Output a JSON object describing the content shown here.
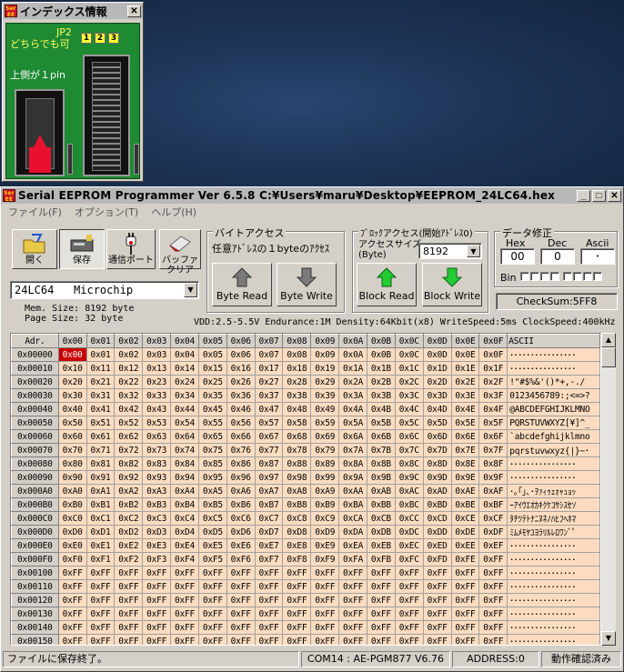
{
  "index_window": {
    "title": "インデックス情報",
    "close": "✕",
    "jp2": "JP2",
    "either_ok": "どちらでも可",
    "jumpers": [
      "1",
      "2",
      "3"
    ],
    "top_side": "上側が１pin",
    "icon_text": "Serial EE"
  },
  "main_window": {
    "title": "Serial EEPROM Programmer Ver 6.5.8  C:¥Users¥maru¥Desktop¥EEPROM_24LC64.hex",
    "icon_text": "Serial EE",
    "controls": {
      "minimize": "_",
      "maximize": "□",
      "close": "✕"
    },
    "menu": [
      "ファイル(F)",
      "オプション(T)",
      "ヘルプ(H)"
    ]
  },
  "toolbar": {
    "open": "開く",
    "save": "保存",
    "port": "通信ポート",
    "buffer_clear_1": "バッファ",
    "buffer_clear_2": "クリア"
  },
  "device": {
    "selected": "24LC64   Microchip",
    "mem_size": "Mem. Size: 8192 byte",
    "page_size": "Page Size: 32 byte",
    "spec": "VDD:2.5-5.5V Endurance:1M Density:64Kbit(x8) WriteSpeed:5ms ClockSpeed:400kHz"
  },
  "byte_access": {
    "group": "バイトアクセス",
    "hint": "任意ｱﾄﾞﾚｽの１byteのｱｸｾｽ",
    "read": "Byte Read",
    "write": "Byte Write"
  },
  "block_access": {
    "group": "ﾌﾞﾛｯｸアクセス(開始ｱﾄﾞﾚｽ0)",
    "size_label_1": "アクセスサイズ",
    "size_label_2": "(Byte)",
    "size_value": "8192",
    "read": "Block Read",
    "write": "Block Write"
  },
  "data_edit": {
    "group": "データ修正",
    "hex_label": "Hex",
    "dec_label": "Dec",
    "ascii_label": "Ascii",
    "hex_value": "00",
    "dec_value": "0",
    "ascii_value": "･",
    "bin_label": "Bin",
    "checksum": "CheckSum:5FF8"
  },
  "grid": {
    "header_addr": "Adr.",
    "header_ascii": "ASCII",
    "columns": [
      "0x00",
      "0x01",
      "0x02",
      "0x03",
      "0x04",
      "0x05",
      "0x06",
      "0x07",
      "0x08",
      "0x09",
      "0x0A",
      "0x0B",
      "0x0C",
      "0x0D",
      "0x0E",
      "0x0F"
    ],
    "rows": [
      {
        "addr": "0x00000",
        "cells": [
          "0x00",
          "0x01",
          "0x02",
          "0x03",
          "0x04",
          "0x05",
          "0x06",
          "0x07",
          "0x08",
          "0x09",
          "0x0A",
          "0x0B",
          "0x0C",
          "0x0D",
          "0x0E",
          "0x0F"
        ],
        "ascii": "････････････････"
      },
      {
        "addr": "0x00010",
        "cells": [
          "0x10",
          "0x11",
          "0x12",
          "0x13",
          "0x14",
          "0x15",
          "0x16",
          "0x17",
          "0x18",
          "0x19",
          "0x1A",
          "0x1B",
          "0x1C",
          "0x1D",
          "0x1E",
          "0x1F"
        ],
        "ascii": "････････････････"
      },
      {
        "addr": "0x00020",
        "cells": [
          "0x20",
          "0x21",
          "0x22",
          "0x23",
          "0x24",
          "0x25",
          "0x26",
          "0x27",
          "0x28",
          "0x29",
          "0x2A",
          "0x2B",
          "0x2C",
          "0x2D",
          "0x2E",
          "0x2F"
        ],
        "ascii": " !\"#$%&'()*+,-./"
      },
      {
        "addr": "0x00030",
        "cells": [
          "0x30",
          "0x31",
          "0x32",
          "0x33",
          "0x34",
          "0x35",
          "0x36",
          "0x37",
          "0x38",
          "0x39",
          "0x3A",
          "0x3B",
          "0x3C",
          "0x3D",
          "0x3E",
          "0x3F"
        ],
        "ascii": "0123456789:;<=>?"
      },
      {
        "addr": "0x00040",
        "cells": [
          "0x40",
          "0x41",
          "0x42",
          "0x43",
          "0x44",
          "0x45",
          "0x46",
          "0x47",
          "0x48",
          "0x49",
          "0x4A",
          "0x4B",
          "0x4C",
          "0x4D",
          "0x4E",
          "0x4F"
        ],
        "ascii": "@ABCDEFGHIJKLMNO"
      },
      {
        "addr": "0x00050",
        "cells": [
          "0x50",
          "0x51",
          "0x52",
          "0x53",
          "0x54",
          "0x55",
          "0x56",
          "0x57",
          "0x58",
          "0x59",
          "0x5A",
          "0x5B",
          "0x5C",
          "0x5D",
          "0x5E",
          "0x5F"
        ],
        "ascii": "PQRSTUVWXYZ[¥]^_"
      },
      {
        "addr": "0x00060",
        "cells": [
          "0x60",
          "0x61",
          "0x62",
          "0x63",
          "0x64",
          "0x65",
          "0x66",
          "0x67",
          "0x68",
          "0x69",
          "0x6A",
          "0x6B",
          "0x6C",
          "0x6D",
          "0x6E",
          "0x6F"
        ],
        "ascii": "`abcdefghijklmno"
      },
      {
        "addr": "0x00070",
        "cells": [
          "0x70",
          "0x71",
          "0x72",
          "0x73",
          "0x74",
          "0x75",
          "0x76",
          "0x77",
          "0x78",
          "0x79",
          "0x7A",
          "0x7B",
          "0x7C",
          "0x7D",
          "0x7E",
          "0x7F"
        ],
        "ascii": "pqrstuvwxyz{|}~･"
      },
      {
        "addr": "0x00080",
        "cells": [
          "0x80",
          "0x81",
          "0x82",
          "0x83",
          "0x84",
          "0x85",
          "0x86",
          "0x87",
          "0x88",
          "0x89",
          "0x8A",
          "0x8B",
          "0x8C",
          "0x8D",
          "0x8E",
          "0x8F"
        ],
        "ascii": "････････････････"
      },
      {
        "addr": "0x00090",
        "cells": [
          "0x90",
          "0x91",
          "0x92",
          "0x93",
          "0x94",
          "0x95",
          "0x96",
          "0x97",
          "0x98",
          "0x99",
          "0x9A",
          "0x9B",
          "0x9C",
          "0x9D",
          "0x9E",
          "0x9F"
        ],
        "ascii": "････････････････"
      },
      {
        "addr": "0x000A0",
        "cells": [
          "0xA0",
          "0xA1",
          "0xA2",
          "0xA3",
          "0xA4",
          "0xA5",
          "0xA6",
          "0xA7",
          "0xA8",
          "0xA9",
          "0xAA",
          "0xAB",
          "0xAC",
          "0xAD",
          "0xAE",
          "0xAF"
        ],
        "ascii": "･｡｢｣､･ｦｧｨｩｪｫｬｭｮｯ"
      },
      {
        "addr": "0x000B0",
        "cells": [
          "0xB0",
          "0xB1",
          "0xB2",
          "0xB3",
          "0xB4",
          "0xB5",
          "0xB6",
          "0xB7",
          "0xB8",
          "0xB9",
          "0xBA",
          "0xBB",
          "0xBC",
          "0xBD",
          "0xBE",
          "0xBF"
        ],
        "ascii": "ｰｱｲｳｴｵｶｷｸｹｺｻｼｽｾｿ"
      },
      {
        "addr": "0x000C0",
        "cells": [
          "0xC0",
          "0xC1",
          "0xC2",
          "0xC3",
          "0xC4",
          "0xC5",
          "0xC6",
          "0xC7",
          "0xC8",
          "0xC9",
          "0xCA",
          "0xCB",
          "0xCC",
          "0xCD",
          "0xCE",
          "0xCF"
        ],
        "ascii": "ﾀﾁﾂﾃﾄﾅﾆﾇﾈﾉﾊﾋﾌﾍﾎﾏ"
      },
      {
        "addr": "0x000D0",
        "cells": [
          "0xD0",
          "0xD1",
          "0xD2",
          "0xD3",
          "0xD4",
          "0xD5",
          "0xD6",
          "0xD7",
          "0xD8",
          "0xD9",
          "0xDA",
          "0xDB",
          "0xDC",
          "0xDD",
          "0xDE",
          "0xDF"
        ],
        "ascii": "ﾐﾑﾒﾓﾔﾕﾖﾗﾘﾙﾚﾛﾜﾝﾞﾟ"
      },
      {
        "addr": "0x000E0",
        "cells": [
          "0xE0",
          "0xE1",
          "0xE2",
          "0xE3",
          "0xE4",
          "0xE5",
          "0xE6",
          "0xE7",
          "0xE8",
          "0xE9",
          "0xEA",
          "0xEB",
          "0xEC",
          "0xED",
          "0xEE",
          "0xEF"
        ],
        "ascii": "････････････････"
      },
      {
        "addr": "0x000F0",
        "cells": [
          "0xF0",
          "0xF1",
          "0xF2",
          "0xF3",
          "0xF4",
          "0xF5",
          "0xF6",
          "0xF7",
          "0xF8",
          "0xF9",
          "0xFA",
          "0xFB",
          "0xFC",
          "0xFD",
          "0xFE",
          "0xFF"
        ],
        "ascii": "････････････････"
      },
      {
        "addr": "0x00100",
        "cells": [
          "0xFF",
          "0xFF",
          "0xFF",
          "0xFF",
          "0xFF",
          "0xFF",
          "0xFF",
          "0xFF",
          "0xFF",
          "0xFF",
          "0xFF",
          "0xFF",
          "0xFF",
          "0xFF",
          "0xFF",
          "0xFF"
        ],
        "ascii": "････････････････"
      },
      {
        "addr": "0x00110",
        "cells": [
          "0xFF",
          "0xFF",
          "0xFF",
          "0xFF",
          "0xFF",
          "0xFF",
          "0xFF",
          "0xFF",
          "0xFF",
          "0xFF",
          "0xFF",
          "0xFF",
          "0xFF",
          "0xFF",
          "0xFF",
          "0xFF"
        ],
        "ascii": "････････････････"
      },
      {
        "addr": "0x00120",
        "cells": [
          "0xFF",
          "0xFF",
          "0xFF",
          "0xFF",
          "0xFF",
          "0xFF",
          "0xFF",
          "0xFF",
          "0xFF",
          "0xFF",
          "0xFF",
          "0xFF",
          "0xFF",
          "0xFF",
          "0xFF",
          "0xFF"
        ],
        "ascii": "････････････････"
      },
      {
        "addr": "0x00130",
        "cells": [
          "0xFF",
          "0xFF",
          "0xFF",
          "0xFF",
          "0xFF",
          "0xFF",
          "0xFF",
          "0xFF",
          "0xFF",
          "0xFF",
          "0xFF",
          "0xFF",
          "0xFF",
          "0xFF",
          "0xFF",
          "0xFF"
        ],
        "ascii": "････････････････"
      },
      {
        "addr": "0x00140",
        "cells": [
          "0xFF",
          "0xFF",
          "0xFF",
          "0xFF",
          "0xFF",
          "0xFF",
          "0xFF",
          "0xFF",
          "0xFF",
          "0xFF",
          "0xFF",
          "0xFF",
          "0xFF",
          "0xFF",
          "0xFF",
          "0xFF"
        ],
        "ascii": "････････････････"
      },
      {
        "addr": "0x00150",
        "cells": [
          "0xFF",
          "0xFF",
          "0xFF",
          "0xFF",
          "0xFF",
          "0xFF",
          "0xFF",
          "0xFF",
          "0xFF",
          "0xFF",
          "0xFF",
          "0xFF",
          "0xFF",
          "0xFF",
          "0xFF",
          "0xFF"
        ],
        "ascii": "････････････････"
      }
    ]
  },
  "status": {
    "message": "ファイルに保存終了。",
    "port": "COM14 : AE-PGM877   V6.76",
    "address": "ADDRESS:0",
    "mode": "動作確認済み"
  },
  "colors": {
    "cell_bg": "#fbdcc0",
    "selected_cell": "#c80000",
    "board": "#1e8a32",
    "arrow_green": "#22cc33"
  }
}
